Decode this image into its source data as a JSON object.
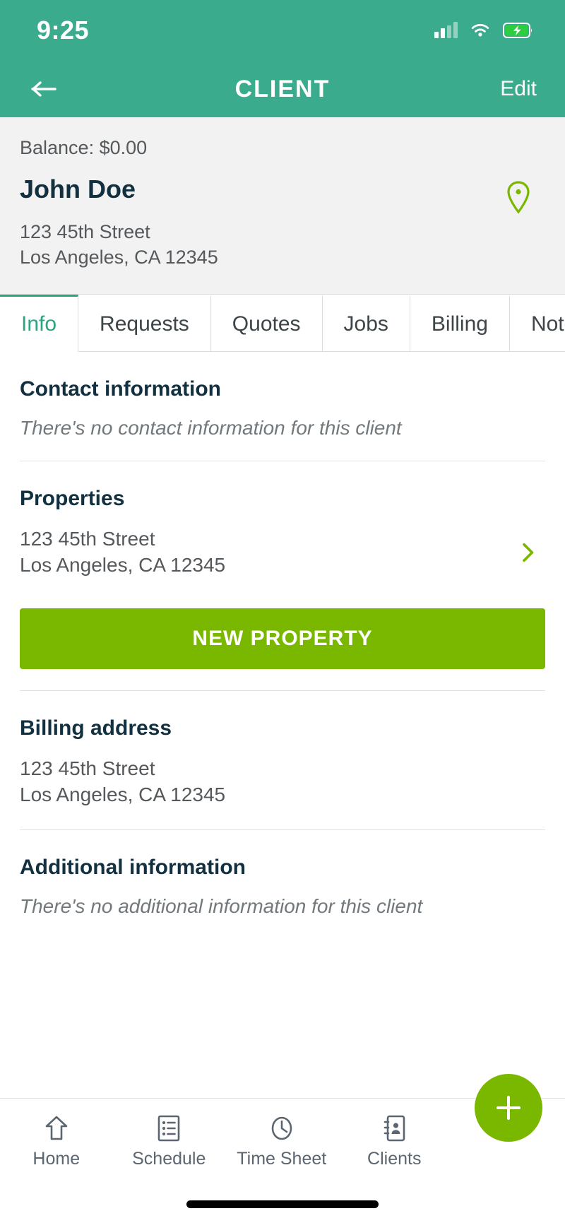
{
  "status_bar": {
    "time": "9:25",
    "signal_icon": "signal-bars-icon",
    "wifi_icon": "wifi-icon",
    "battery_icon": "battery-charging-icon"
  },
  "header": {
    "back_icon": "arrow-left-icon",
    "title": "CLIENT",
    "edit_label": "Edit",
    "background_color": "#3bab8e"
  },
  "client": {
    "balance_label": "Balance: $0.00",
    "name": "John Doe",
    "address_line1": "123 45th Street",
    "address_line2": "Los Angeles, CA 12345",
    "map_pin_icon": "map-pin-icon",
    "pin_color": "#7ab800"
  },
  "tabs": {
    "active_color": "#2aa57f",
    "items": [
      {
        "label": "Info",
        "active": true
      },
      {
        "label": "Requests",
        "active": false
      },
      {
        "label": "Quotes",
        "active": false
      },
      {
        "label": "Jobs",
        "active": false
      },
      {
        "label": "Billing",
        "active": false
      },
      {
        "label": "Notes",
        "active": false
      }
    ]
  },
  "sections": {
    "contact": {
      "title": "Contact information",
      "empty_text": "There's no contact information for this client"
    },
    "properties": {
      "title": "Properties",
      "address_line1": "123 45th Street",
      "address_line2": "Los Angeles, CA 12345",
      "chevron_icon": "chevron-right-icon",
      "new_property_label": "NEW PROPERTY",
      "button_color": "#7ab800"
    },
    "billing": {
      "title": "Billing address",
      "address_line1": "123 45th Street",
      "address_line2": "Los Angeles, CA 12345"
    },
    "additional": {
      "title": "Additional information",
      "empty_text": "There's no additional information for this client"
    }
  },
  "bottom_nav": {
    "items": [
      {
        "label": "Home",
        "icon": "home-icon"
      },
      {
        "label": "Schedule",
        "icon": "list-icon"
      },
      {
        "label": "Time Sheet",
        "icon": "clock-icon"
      },
      {
        "label": "Clients",
        "icon": "contact-book-icon"
      }
    ],
    "fab": {
      "icon": "plus-icon",
      "color": "#7ab800"
    }
  }
}
